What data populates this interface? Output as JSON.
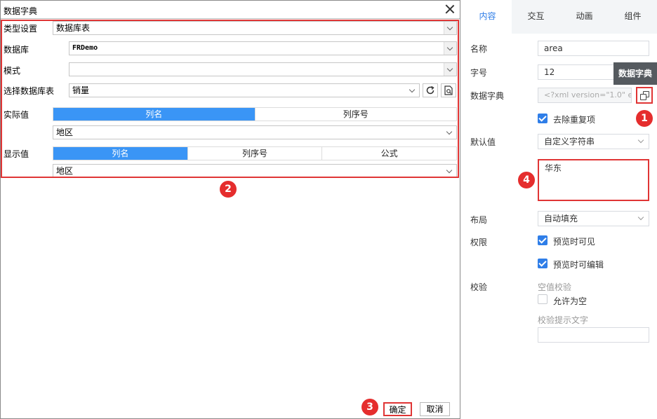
{
  "dialog": {
    "title": "数据字典",
    "type_label": "类型设置",
    "type_value": "数据库表",
    "db_label": "数据库",
    "db_value": "FRDemo",
    "mode_label": "模式",
    "mode_value": "",
    "table_label": "选择数据库表",
    "table_value": "销量",
    "actual_label": "实际值",
    "actual_options": [
      "列名",
      "列序号"
    ],
    "actual_value": "地区",
    "display_label": "显示值",
    "display_options": [
      "列名",
      "列序号",
      "公式"
    ],
    "display_value": "地区",
    "ok": "确定",
    "cancel": "取消"
  },
  "panel": {
    "tabs": [
      "内容",
      "交互",
      "动画",
      "组件"
    ],
    "active_tab": "内容",
    "name_label": "名称",
    "name_value": "area",
    "font_label": "字号",
    "font_value": "12",
    "dict_label": "数据字典",
    "dict_value": "<?xml version=\"1.0\" en",
    "tooltip": "数据字典",
    "dedupe_label": "去除重复项",
    "default_label": "默认值",
    "default_type": "自定义字符串",
    "default_value": "华东",
    "layout_label": "布局",
    "layout_value": "自动填充",
    "perm_label": "权限",
    "perm_visible": "预览时可见",
    "perm_editable": "预览时可编辑",
    "verify_label": "校验",
    "verify_empty_title": "空值校验",
    "allow_empty": "允许为空",
    "hint_label": "校验提示文字",
    "hint_value": ""
  },
  "badges": [
    "1",
    "2",
    "3",
    "4"
  ],
  "colors": {
    "accent": "#3a95f6",
    "highlight": "#e03535",
    "tab_active": "#2f7ee8"
  }
}
